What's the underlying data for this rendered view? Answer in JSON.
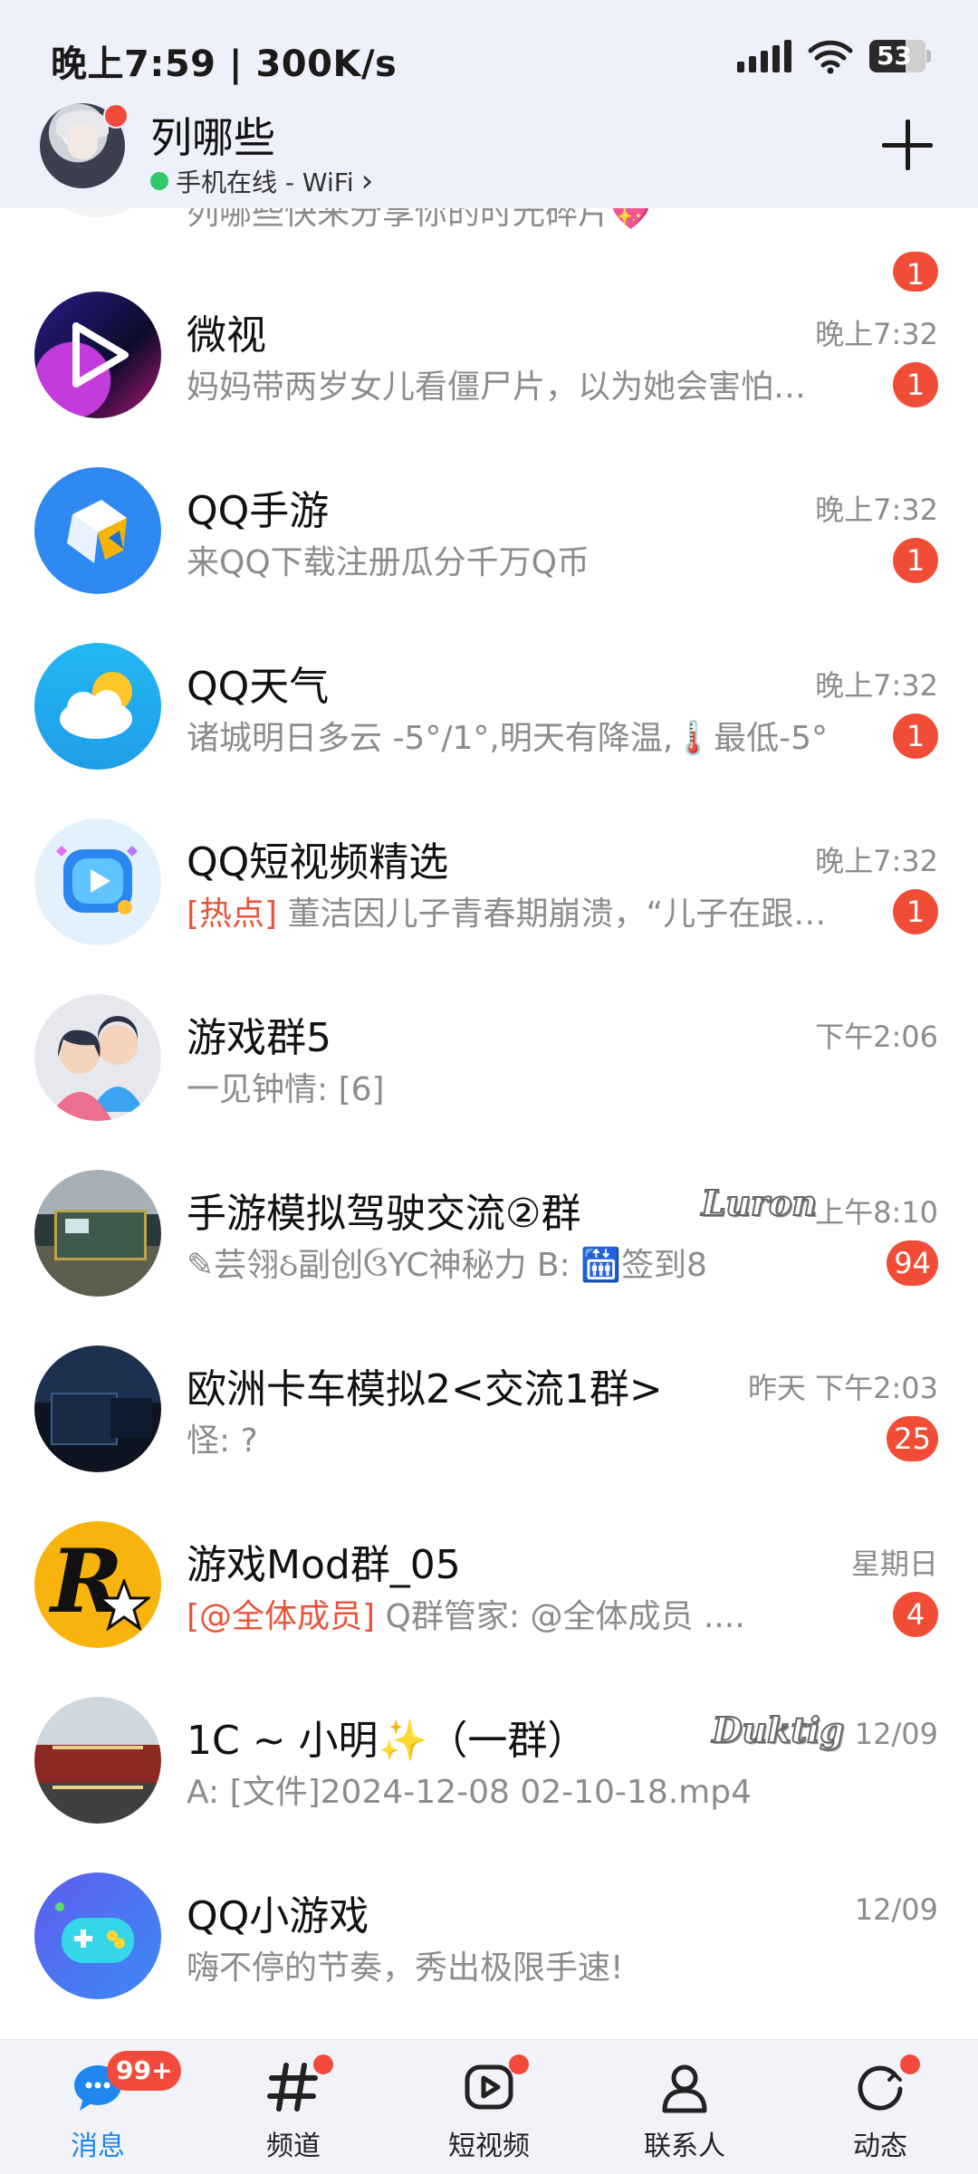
{
  "status_bar": {
    "time": "晚上7:59 | 300K/s",
    "battery": "53"
  },
  "profile": {
    "name": "列哪些",
    "status": "手机在线 - WiFi",
    "chevron": "›"
  },
  "chats": [
    {
      "title": "",
      "time": "",
      "tag": "",
      "preview": "列哪些快来分享你的时光碎片💖",
      "badge": "1"
    },
    {
      "title": "微视",
      "time": "晚上7:32",
      "tag": "",
      "preview": "妈妈带两岁女儿看僵尸片，以为她会害怕…",
      "badge": "1"
    },
    {
      "title": "QQ手游",
      "time": "晚上7:32",
      "tag": "",
      "preview": "来QQ下载注册瓜分千万Q币",
      "badge": "1"
    },
    {
      "title": "QQ天气",
      "time": "晚上7:32",
      "tag": "",
      "preview": "诸城明日多云 -5°/1°,明天有降温,🌡️最低-5°",
      "badge": "1"
    },
    {
      "title": "QQ短视频精选",
      "time": "晚上7:32",
      "tag": "[热点]",
      "preview": " 董洁因儿子青春期崩溃，“儿子在跟…",
      "badge": "1"
    },
    {
      "title": "游戏群5",
      "time": "下午2:06",
      "tag": "",
      "preview": "一见钟情: [6]",
      "badge": ""
    },
    {
      "title": "手游模拟驾驶交流②群",
      "time": "上午8:10",
      "sticker": "Luron",
      "tag": "",
      "preview": "✎芸翎ઠ副创ઉYC神秘力 B: 🛗签到8",
      "badge": "94"
    },
    {
      "title": "欧洲卡车模拟2<交流1群>",
      "time": "昨天 下午2:03",
      "tag": "",
      "preview": "怪: ?",
      "badge": "25"
    },
    {
      "title": "游戏Mod群_05",
      "time": "星期日",
      "tag": "[@全体成员]",
      "preview": " Q群管家: @全体成员 ....",
      "badge": "4"
    },
    {
      "title": "1C ~ 小明✨（一群）",
      "time": "12/09",
      "sticker": "Duktig",
      "tag": "",
      "preview": "A: [文件]2024-12-08 02-10-18.mp4",
      "badge": ""
    },
    {
      "title": "QQ小游戏",
      "time": "12/09",
      "tag": "",
      "preview": "嗨不停的节奏，秀出极限手速!",
      "badge": ""
    }
  ],
  "nav": {
    "messages": {
      "label": "消息",
      "count": "99+"
    },
    "channels": {
      "label": "频道"
    },
    "short_video": {
      "label": "短视频"
    },
    "contacts": {
      "label": "联系人"
    },
    "moments": {
      "label": "动态"
    }
  },
  "colors": {
    "accent": "#1e88f0",
    "badge": "#f14c36",
    "tag": "#e8533a"
  }
}
